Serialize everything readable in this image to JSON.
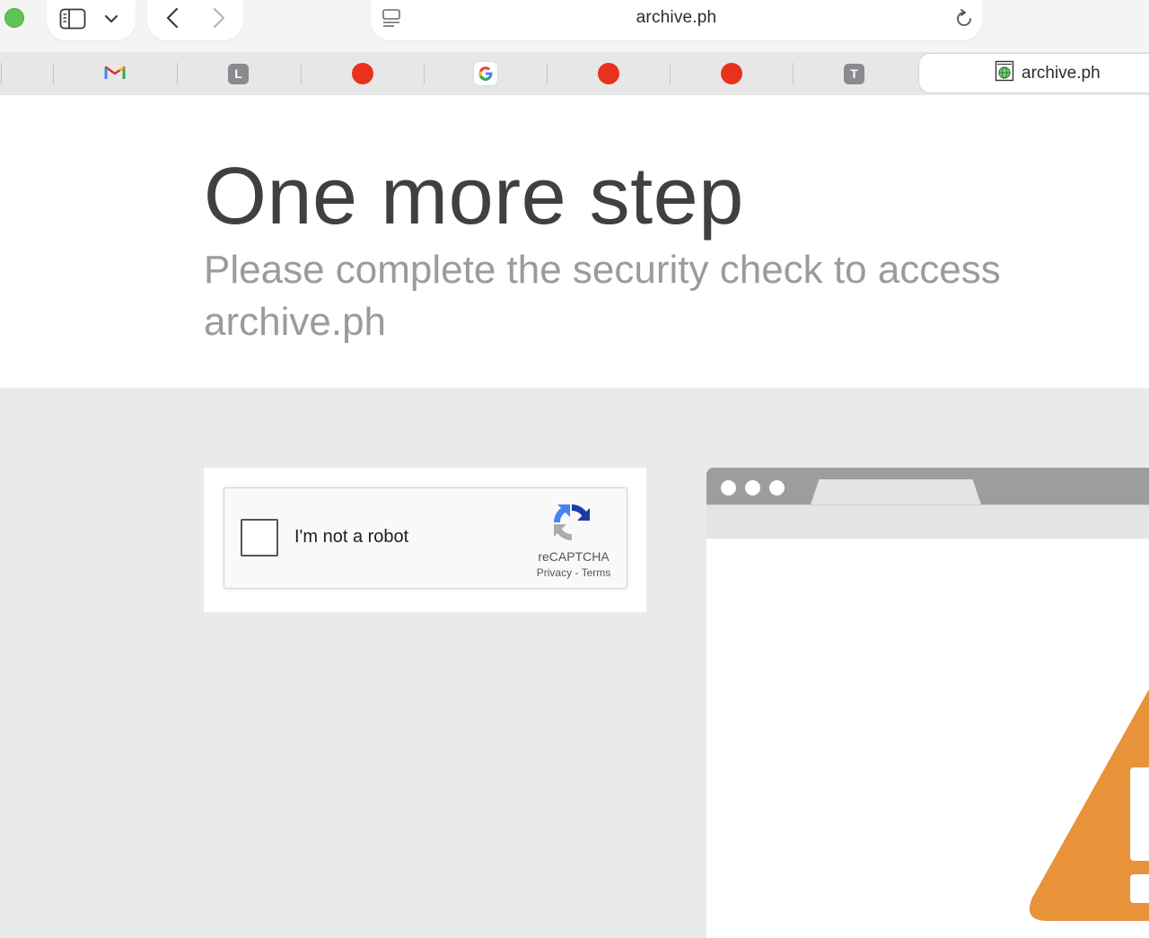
{
  "browser": {
    "url": "archive.ph",
    "tabs": [
      {
        "favicon": "gmail-icon"
      },
      {
        "favicon": "letter-icon",
        "letter": "L"
      },
      {
        "favicon": "red-dot-icon"
      },
      {
        "favicon": "google-icon"
      },
      {
        "favicon": "red-dot-icon"
      },
      {
        "favicon": "red-dot-icon"
      },
      {
        "favicon": "letter-icon",
        "letter": "T"
      }
    ],
    "active_tab": {
      "title": "archive.ph",
      "favicon": "archive-globe-icon"
    }
  },
  "page": {
    "title": "One more step",
    "subtitle": "Please complete the security check to access archive.ph"
  },
  "captcha": {
    "label": "I'm not a robot",
    "brand": "reCAPTCHA",
    "privacy": "Privacy",
    "separator": "-",
    "terms": "Terms",
    "checked": false
  },
  "colors": {
    "warning": "#e8923a",
    "title": "#404040",
    "subtitle": "#9b9b9b",
    "body_bg": "#eaeaea"
  }
}
